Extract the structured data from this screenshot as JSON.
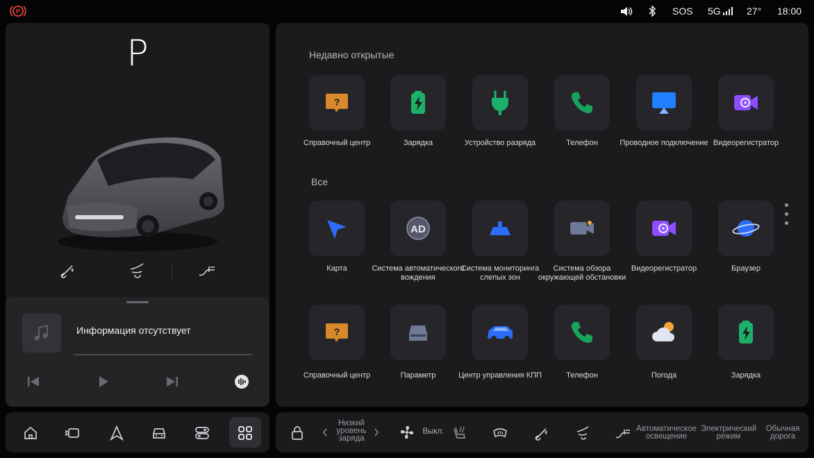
{
  "status_bar": {
    "sos": "SOS",
    "network": "5G",
    "temperature": "27°",
    "time": "18:00",
    "icons": [
      "parking-brake-icon",
      "volume-icon",
      "bluetooth-icon",
      "signal-icon"
    ]
  },
  "vehicle": {
    "gear": "P"
  },
  "media": {
    "title": "Информация отсутствует",
    "progress": 0
  },
  "recent": {
    "title": "Недавно открытые",
    "apps": [
      {
        "label": "Справочный центр",
        "icon": "help-center-icon",
        "color": "#d9892b"
      },
      {
        "label": "Зарядка",
        "icon": "battery-charge-icon",
        "color": "#1db06a"
      },
      {
        "label": "Устройство разряда",
        "icon": "discharge-plug-icon",
        "color": "#1db06a"
      },
      {
        "label": "Телефон",
        "icon": "phone-icon",
        "color": "#18a35c"
      },
      {
        "label": "Проводное подключение",
        "icon": "screen-cast-icon",
        "color": "#1f7fff"
      },
      {
        "label": "Видеорегистратор",
        "icon": "dashcam-icon",
        "color": "#8b4dff"
      }
    ]
  },
  "all": {
    "title": "Все",
    "apps": [
      {
        "label": "Карта",
        "icon": "navigation-arrow-icon",
        "color": "#2d6cf6"
      },
      {
        "label": "Система автоматического вождения",
        "icon": "auto-drive-icon",
        "color": "#55586a"
      },
      {
        "label": "Система мониторинга слепых зон",
        "icon": "blind-spot-icon",
        "color": "#2d6cf6"
      },
      {
        "label": "Система обзора окружающей обстановки",
        "icon": "surround-camera-icon",
        "color": "#6c7a96"
      },
      {
        "label": "Видеорегистратор",
        "icon": "dashcam-icon",
        "color": "#8b4dff"
      },
      {
        "label": "Браузер",
        "icon": "planet-browser-icon",
        "color": "#2d6cf6"
      },
      {
        "label": "Справочный центр",
        "icon": "help-center-icon",
        "color": "#d9892b"
      },
      {
        "label": "Параметр",
        "icon": "car-settings-icon",
        "color": "#6c7a96"
      },
      {
        "label": "Центр управления КПП",
        "icon": "suv-icon",
        "color": "#2d6cf6"
      },
      {
        "label": "Телефон",
        "icon": "phone-icon",
        "color": "#18a35c"
      },
      {
        "label": "Погода",
        "icon": "weather-icon",
        "color": "#f3a33a"
      },
      {
        "label": "Зарядка",
        "icon": "battery-charge-icon",
        "color": "#1db06a"
      }
    ]
  },
  "dock": {
    "nav": [
      "home-icon",
      "camera-view-icon",
      "navigation-icon",
      "car-front-icon",
      "toggles-icon",
      "apps-grid-icon"
    ],
    "charge_level": "Низкий уровень заряда",
    "fan": "Выкл.",
    "lighting": "Автоматическое освещение",
    "drive_mode": "Электрический режим",
    "road_mode": "Обычная дорога"
  }
}
